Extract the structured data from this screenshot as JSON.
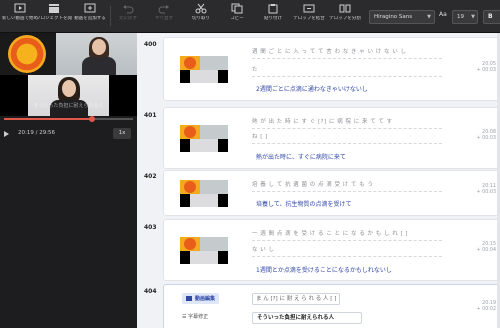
{
  "toolbar": {
    "buttons": [
      {
        "label": "新しい動画で始める",
        "icon": "new-video-icon",
        "disabled": false
      },
      {
        "label": "プロジェクトを開く",
        "icon": "clapper-icon",
        "disabled": false
      },
      {
        "label": "動画を追加する",
        "icon": "add-video-icon",
        "disabled": false
      },
      {
        "label": "元に戻す",
        "icon": "undo-icon",
        "disabled": true
      },
      {
        "label": "やり直す",
        "icon": "redo-icon",
        "disabled": true
      },
      {
        "label": "切り取り",
        "icon": "scissors-icon",
        "disabled": false
      },
      {
        "label": "コピー",
        "icon": "copy-icon",
        "disabled": false
      },
      {
        "label": "貼り付け",
        "icon": "paste-icon",
        "disabled": false
      },
      {
        "label": "テロップを結合",
        "icon": "merge-icon",
        "disabled": false
      },
      {
        "label": "テロップを分割",
        "icon": "split-icon",
        "disabled": false
      }
    ],
    "font": "Hiragino Sans",
    "font_size": "19",
    "bold": "B"
  },
  "player": {
    "caption": "そういった負担に耐えられる人",
    "timecode": "20:19 / 29:56",
    "progress": 0.68,
    "speed": "1x"
  },
  "rows": [
    {
      "num": "400",
      "tokens1": "週 間  ご と  に  入  っ て  て  言 わ  な き ゃ  い け  な い  し",
      "tokens2": "た",
      "sentence": "2週間ごとに点滴に通わなきゃいけないし",
      "t1": "20:05",
      "t2": "+ 00:03"
    },
    {
      "num": "401",
      "tokens1": "熱  が  出  た  時  に  す ぐ  [?]  に  病 院  に  来  て  て す",
      "tokens2": "ね  [ ]",
      "sentence": "熱が出た時に、すぐに病院に来て",
      "t1": "20:08",
      "t2": "+ 00:03"
    },
    {
      "num": "402",
      "tokens1": "培 養  し  て  抗 遺  菌  の  点 滴  受  け  て  も う",
      "tokens2": "",
      "sentence": "培養して、抗生物質の点滴を受けて",
      "t1": "20:11",
      "t2": "+ 00:03"
    },
    {
      "num": "403",
      "tokens1": "一  週 間  点 滴  を  受 け る  こ と  に  な る  か  も  し れ  [ ]",
      "tokens2": "な い  し",
      "sentence": "1週間とか点滴を受けることになるかもしれないし",
      "t1": "20:15",
      "t2": "+ 00:04"
    },
    {
      "num": "404",
      "tag1": "動画編集",
      "tag2": "字幕修正",
      "chips": "ま ん  [?]  に  耐 え  ら れ る  人  [ ]",
      "sentence": "そういった負担に耐えられる人",
      "t1": "20:19",
      "t2": "+ 00:02"
    }
  ]
}
